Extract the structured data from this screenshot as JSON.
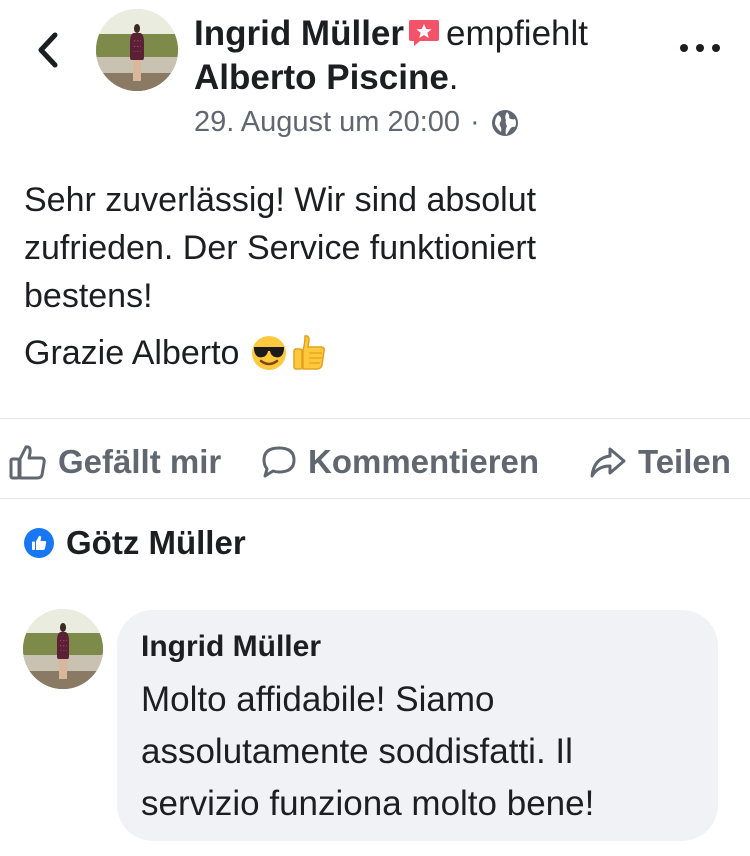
{
  "header": {
    "author_name": "Ingrid Müller",
    "verb": "empfiehlt",
    "page_name": "Alberto Piscine",
    "page_suffix": ".",
    "timestamp": "29. August um 20:00",
    "separator": "·",
    "audience_icon": "globe-icon",
    "back_icon": "chevron-left-icon",
    "more_icon": "more-dots-icon",
    "recommend_icon": "recommend-star-icon",
    "recommend_color": "#f35369"
  },
  "post": {
    "lines": [
      "Sehr zuverlässig! Wir sind absolut",
      "zufrieden. Der Service funktioniert",
      "bestens!"
    ],
    "closing": "Grazie Alberto",
    "emojis": [
      "sunglasses-emoji",
      "thumbs-up-emoji"
    ]
  },
  "actions": {
    "like_label": "Gefällt mir",
    "comment_label": "Kommentieren",
    "share_label": "Teilen"
  },
  "likes": {
    "name": "Götz Müller",
    "badge_color": "#1877f2"
  },
  "comment": {
    "author": "Ingrid Müller",
    "text_lines": [
      "Molto affidabile! Siamo",
      "assolutamente soddisfatti. Il",
      "servizio funziona molto bene!"
    ]
  },
  "colors": {
    "text": "#1c1e21",
    "secondary": "#606770",
    "bubble": "#f0f2f5",
    "divider": "#e4e6eb"
  }
}
